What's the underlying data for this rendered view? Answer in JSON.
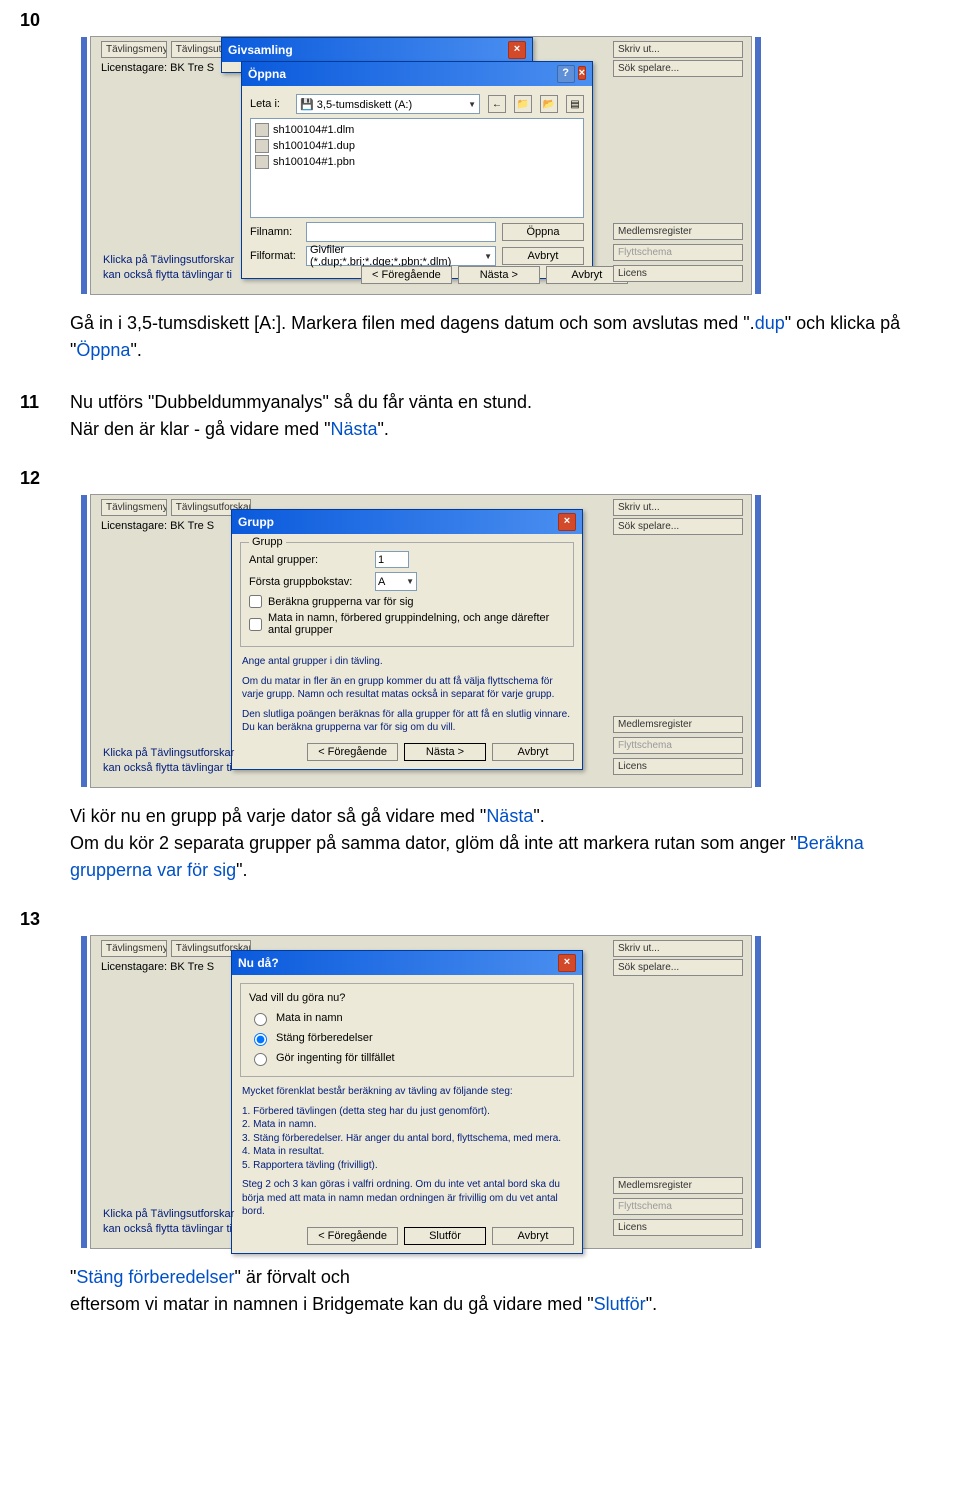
{
  "steps": {
    "s10": {
      "num": "10"
    },
    "s10text": {
      "t1": "Gå in i 3,5-tumsdiskett [A:]. Markera filen med dagens datum och som avslutas med \".",
      "dup": "dup",
      "t2": "\" och klicka på \"",
      "oppna": "Öppna",
      "t3": "\"."
    },
    "s11": {
      "num": "11",
      "t1": "Nu utförs \"Dubbeldummyanalys\" så du får vänta en stund.",
      "t2": "När den är klar - gå vidare med \"",
      "nasta": "Nästa",
      "t3": "\"."
    },
    "s12": {
      "num": "12"
    },
    "s12text": {
      "t1": "Vi kör nu en grupp på varje dator så gå vidare med \"",
      "nasta": "Nästa",
      "t2": "\".",
      "t3": "Om du kör 2 separata grupper på samma dator, glöm då inte att markera rutan som anger \"",
      "berakna": "Beräkna grupperna var för sig",
      "t4": "\"."
    },
    "s13": {
      "num": "13"
    },
    "s13text": {
      "t1": "\"",
      "stang": "Stäng förberedelser",
      "t2": "\" är förvalt och",
      "t3": "eftersom vi matar in namnen i Bridgemate kan du gå vidare med \"",
      "slutfor": "Slutför",
      "t4": "\"."
    }
  },
  "common": {
    "tavlingsmeny": "Tävlingsmeny...",
    "tavlingsutforskaren": "Tävlingsutforskaren",
    "licenstagare": "Licenstagare: BK Tre S",
    "skrivut": "Skriv ut...",
    "sokspelare": "Sök spelare...",
    "medlemsregister": "Medlemsregister",
    "flyttschema": "Flyttschema",
    "licens": "Licens",
    "hint1": "Klicka på Tävlingsutforskar",
    "hint2": "kan också flytta tävlingar ti",
    "foregaende": "< Föregående",
    "nasta": "Nästa >",
    "avbryt": "Avbryt",
    "slutfor": "Slutför"
  },
  "shot10": {
    "givsamling": "Givsamling",
    "oppna_title": "Öppna",
    "leta": "Leta i:",
    "drive": "3,5-tumsdiskett (A:)",
    "files": [
      "sh100104#1.dlm",
      "sh100104#1.dup",
      "sh100104#1.pbn"
    ],
    "filnamn": "Filnamn:",
    "filformat": "Filformat:",
    "filter": "Givfiler (*.dup;*.bri;*.dge;*.pbn;*.dlm)",
    "oppna_btn": "Öppna",
    "avbryt": "Avbryt"
  },
  "shot12": {
    "title": "Grupp",
    "grupp_legend": "Grupp",
    "antal_grupper": "Antal grupper:",
    "antal_val": "1",
    "forsta": "Första gruppbokstav:",
    "forsta_val": "A",
    "chk1": "Beräkna grupperna var för sig",
    "chk2": "Mata in namn, förbered gruppindelning, och ange därefter antal grupper",
    "h1": "Ange antal grupper i din tävling.",
    "h2": "Om du matar in fler än en grupp kommer du att få välja flyttschema för varje grupp. Namn och resultat matas också in separat för varje grupp.",
    "h3": "Den slutliga poängen beräknas för alla grupper för att få en slutlig vinnare. Du kan beräkna grupperna var för sig om du vill."
  },
  "shot13": {
    "title": "Nu då?",
    "q": "Vad vill du göra nu?",
    "r1": "Mata in namn",
    "r2": "Stäng förberedelser",
    "r3": "Gör ingenting för tillfället",
    "info_head": "Mycket förenklat består beräkning av tävling av följande steg:",
    "l1": "1. Förbered tävlingen (detta steg har du just genomfört).",
    "l2": "2. Mata in namn.",
    "l3": "3. Stäng förberedelser. Här anger du antal bord, flyttschema, med mera.",
    "l4": "4. Mata in resultat.",
    "l5": "5. Rapportera tävling (frivilligt).",
    "foot": "Steg 2 och 3 kan göras i valfri ordning. Om du inte vet antal bord ska du börja med att mata in namn medan ordningen är frivillig om du vet antal bord."
  }
}
